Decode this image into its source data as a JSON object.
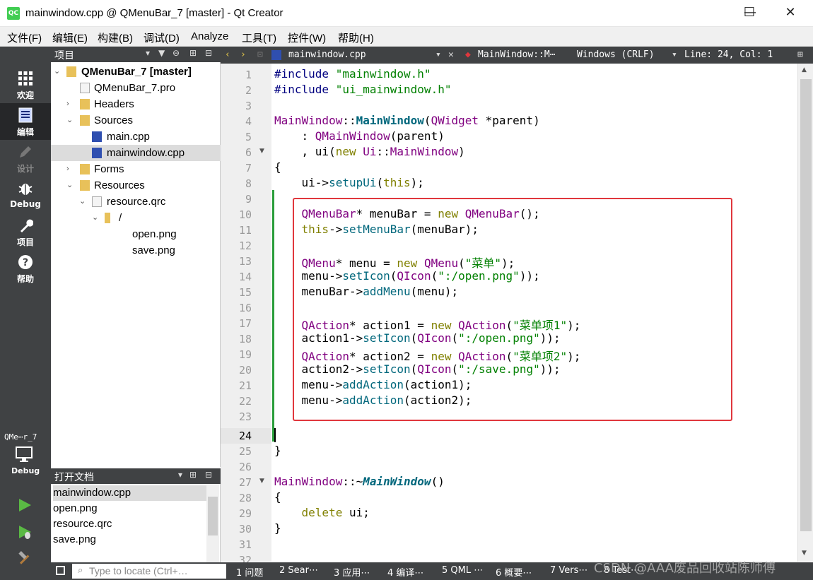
{
  "window": {
    "title": "mainwindow.cpp @ QMenuBar_7 [master] - Qt Creator",
    "app_icon": "QC",
    "minimize": "—",
    "maximize": "☐",
    "close": "✕"
  },
  "menubar": [
    "文件(F)",
    "编辑(E)",
    "构建(B)",
    "调试(D)",
    "Analyze",
    "工具(T)",
    "控件(W)",
    "帮助(H)"
  ],
  "modes": [
    {
      "label": "欢迎",
      "icon": "grid-icon"
    },
    {
      "label": "编辑",
      "icon": "edit-icon"
    },
    {
      "label": "设计",
      "icon": "pencil-icon"
    },
    {
      "label": "Debug",
      "icon": "bug-icon"
    },
    {
      "label": "项目",
      "icon": "wrench-icon"
    },
    {
      "label": "帮助",
      "icon": "help-icon"
    }
  ],
  "kit": {
    "name": "QMe⋯r_7",
    "config": "Debug"
  },
  "project_pane": {
    "title": "项目",
    "tree": [
      "QMenuBar_7 [master]",
      "QMenuBar_7.pro",
      "Headers",
      "Sources",
      "main.cpp",
      "mainwindow.cpp",
      "Forms",
      "Resources",
      "resource.qrc",
      "/",
      "open.png",
      "save.png"
    ]
  },
  "open_docs": {
    "title": "打开文档",
    "items": [
      "mainwindow.cpp",
      "open.png",
      "resource.qrc",
      "save.png"
    ]
  },
  "editor": {
    "file": "mainwindow.cpp",
    "symbol": "MainWindow::M⋯",
    "line_ending": "Windows (CRLF)",
    "position": "Line: 24, Col: 1",
    "current_line": 24,
    "line_numbers": [
      "1",
      "2",
      "3",
      "4",
      "5",
      "6",
      "7",
      "8",
      "9",
      "10",
      "11",
      "12",
      "13",
      "14",
      "15",
      "16",
      "17",
      "18",
      "19",
      "20",
      "21",
      "22",
      "23",
      "24",
      "25",
      "26",
      "27",
      "28",
      "29",
      "30",
      "31",
      "32"
    ],
    "code": {
      "l1a": "#include ",
      "l1b": "\"mainwindow.h\"",
      "l2a": "#include ",
      "l2b": "\"ui_mainwindow.h\"",
      "l4a": "MainWindow",
      "l4b": "::",
      "l4c": "MainWindow",
      "l4d": "(",
      "l4e": "QWidget",
      "l4f": " *parent)",
      "l5a": "    : ",
      "l5b": "QMainWindow",
      "l5c": "(parent)",
      "l6a": "    , ui(",
      "l6b": "new",
      "l6c": " ",
      "l6d": "Ui",
      "l6e": "::",
      "l6f": "MainWindow",
      "l6g": ")",
      "l7": "{",
      "l8a": "    ui->",
      "l8b": "setupUi",
      "l8c": "(",
      "l8d": "this",
      "l8e": ");",
      "l10a": "    ",
      "l10b": "QMenuBar",
      "l10c": "* menuBar = ",
      "l10d": "new",
      "l10e": " ",
      "l10f": "QMenuBar",
      "l10g": "();",
      "l11a": "    ",
      "l11b": "this",
      "l11c": "->",
      "l11d": "setMenuBar",
      "l11e": "(menuBar);",
      "l13a": "    ",
      "l13b": "QMenu",
      "l13c": "* menu = ",
      "l13d": "new",
      "l13e": " ",
      "l13f": "QMenu",
      "l13g": "(",
      "l13h": "\"菜单\"",
      "l13i": ");",
      "l14a": "    menu->",
      "l14b": "setIcon",
      "l14c": "(",
      "l14d": "QIcon",
      "l14e": "(",
      "l14f": "\":/open.png\"",
      "l14g": "));",
      "l15a": "    menuBar->",
      "l15b": "addMenu",
      "l15c": "(menu);",
      "l17a": "    ",
      "l17b": "QAction",
      "l17c": "* action1 = ",
      "l17d": "new",
      "l17e": " ",
      "l17f": "QAction",
      "l17g": "(",
      "l17h": "\"菜单项1\"",
      "l17i": ");",
      "l18a": "    action1->",
      "l18b": "setIcon",
      "l18c": "(",
      "l18d": "QIcon",
      "l18e": "(",
      "l18f": "\":/open.png\"",
      "l18g": "));",
      "l19a": "    ",
      "l19b": "QAction",
      "l19c": "* action2 = ",
      "l19d": "new",
      "l19e": " ",
      "l19f": "QAction",
      "l19g": "(",
      "l19h": "\"菜单项2\"",
      "l19i": ");",
      "l20a": "    action2->",
      "l20b": "setIcon",
      "l20c": "(",
      "l20d": "QIcon",
      "l20e": "(",
      "l20f": "\":/save.png\"",
      "l20g": "));",
      "l21a": "    menu->",
      "l21b": "addAction",
      "l21c": "(action1);",
      "l22a": "    menu->",
      "l22b": "addAction",
      "l22c": "(action2);",
      "l25": "}",
      "l27a": "MainWindow",
      "l27b": "::~",
      "l27c": "MainWindow",
      "l27d": "()",
      "l28": "{",
      "l29a": "    ",
      "l29b": "delete",
      "l29c": " ui;",
      "l30": "}"
    }
  },
  "statusbar": {
    "locate_placeholder": "Type to locate (Ctrl+…",
    "panes": [
      "1 问题",
      "2 Sear⋯",
      "3 应用⋯",
      "4 编译⋯",
      "5 QML ⋯",
      "6 概要⋯",
      "7 Vers⋯",
      "8 Test⋯"
    ]
  },
  "watermark": "CSDN @AAA废品回收站陈师傅",
  "colors": {
    "accent_highlight": "#e0373d",
    "sidebar": "#404244",
    "keyword": "#808000",
    "type": "#800080",
    "function": "#00677c",
    "string": "#008000"
  }
}
